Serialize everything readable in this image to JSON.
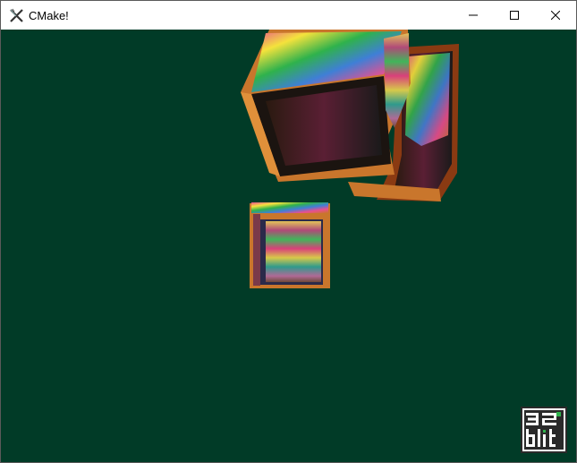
{
  "window": {
    "title": "CMake!",
    "app_icon": "x-logo-icon",
    "controls": {
      "minimize_icon": "minimize-icon",
      "maximize_icon": "maximize-icon",
      "close_icon": "close-icon"
    }
  },
  "viewport": {
    "background_color": "#013b27",
    "scene": "rotating-rainbow-crates",
    "crate_colors": [
      "#c9762c",
      "#e94f8f",
      "#2fb24c",
      "#f4e23c",
      "#3f7fd6",
      "#8a3a12"
    ],
    "logo": {
      "lines": [
        "32",
        "blit"
      ],
      "icon": "32blit-logo-icon"
    }
  }
}
